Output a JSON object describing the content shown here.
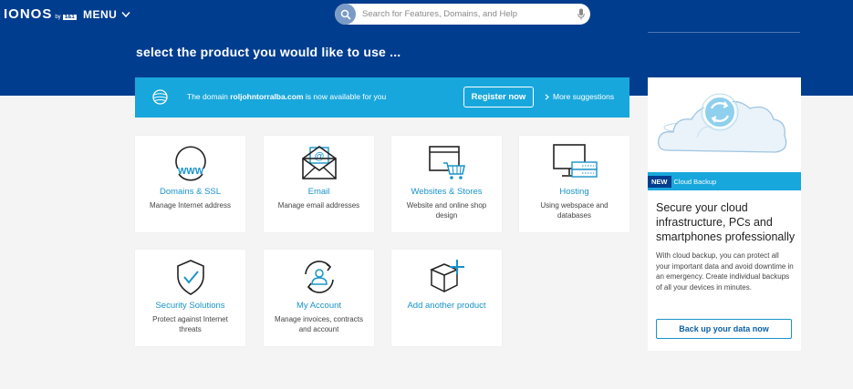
{
  "header": {
    "logo_text": "IONOS",
    "logo_by": "by",
    "logo_badge": "1&1",
    "menu_label": "MENU",
    "search_placeholder": "Search for Features, Domains, and Help"
  },
  "page": {
    "title": "select the product you would like to use ..."
  },
  "banner": {
    "text_before": "The domain ",
    "domain": "roljohntorralba.com",
    "text_after": " is now available for you",
    "register_label": "Register now",
    "more_label": "More suggestions"
  },
  "cards": [
    {
      "title": "Domains & SSL",
      "desc": "Manage Internet address",
      "icon": "globe-www-icon"
    },
    {
      "title": "Email",
      "desc": "Manage email addresses",
      "icon": "envelope-icon"
    },
    {
      "title": "Websites & Stores",
      "desc": "Website and online shop design",
      "icon": "browser-cart-icon"
    },
    {
      "title": "Hosting",
      "desc": "Using webspace and databases",
      "icon": "monitor-server-icon"
    },
    {
      "title": "Security Solutions",
      "desc": "Protect against Internet threats",
      "icon": "shield-check-icon"
    },
    {
      "title": "My Account",
      "desc": "Manage invoices, contracts and account",
      "icon": "user-cycle-icon"
    },
    {
      "title": "Add another product",
      "desc": "",
      "icon": "box-plus-icon"
    }
  ],
  "promo": {
    "badge": "NEW",
    "strip_label": "Cloud Backup",
    "heading": "Secure your cloud infrastructure, PCs and smartphones professionally",
    "body": "With cloud backup, you can protect all your important data and avoid downtime in an emergency. Create individual backups of all your devices in minutes.",
    "button_label": "Back up your data now"
  },
  "colors": {
    "header_blue": "#003d8f",
    "accent_cyan": "#18a7dc",
    "link_blue": "#1893c9",
    "page_bg": "#f4f4f4"
  }
}
